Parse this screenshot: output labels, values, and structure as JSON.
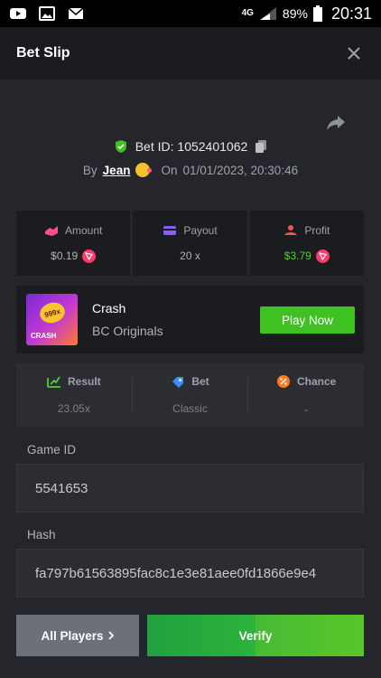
{
  "status_bar": {
    "network": "4G",
    "battery": "89%",
    "time": "20:31",
    "icons": [
      "youtube-icon",
      "gallery-icon",
      "mail-icon",
      "signal-icon",
      "battery-icon"
    ]
  },
  "header": {
    "title": "Bet Slip",
    "close_icon": "close-icon"
  },
  "bet": {
    "id_text": "Bet ID: 1052401062",
    "by_label": "By",
    "user": "Jean",
    "on_label": "On",
    "timestamp": "01/01/2023, 20:30:46"
  },
  "stats": [
    {
      "label": "Amount",
      "value": "$0.19",
      "icon": "amount-icon",
      "color": "#ff4e8b"
    },
    {
      "label": "Payout",
      "value": "20 x",
      "icon": "payout-icon",
      "color": "#8a5cff"
    },
    {
      "label": "Profit",
      "value": "$3.79",
      "icon": "profit-icon",
      "color": "#ff4e4e",
      "value_color": "#4cd137"
    }
  ],
  "game": {
    "name": "Crash",
    "provider": "BC Originals",
    "thumb_coin": "999x",
    "thumb_label": "CRASH",
    "play_label": "Play Now"
  },
  "result": [
    {
      "label": "Result",
      "value": "23.05x",
      "icon": "result-icon",
      "color": "#4cd137"
    },
    {
      "label": "Bet",
      "value": "Classic",
      "icon": "bet-icon",
      "color": "#3a8cff"
    },
    {
      "label": "Chance",
      "value": "-",
      "icon": "chance-icon",
      "color": "#ff7a1a"
    }
  ],
  "fields": {
    "game_id_label": "Game ID",
    "game_id_value": "5541653",
    "hash_label": "Hash",
    "hash_value": "fa797b61563895fac8c1e3e81aee0fd1866e9e4"
  },
  "buttons": {
    "all_players": "All Players",
    "verify": "Verify"
  },
  "colors": {
    "accent_green": "#3ec121",
    "panel": "#1b1c1f",
    "background": "#24262b"
  }
}
